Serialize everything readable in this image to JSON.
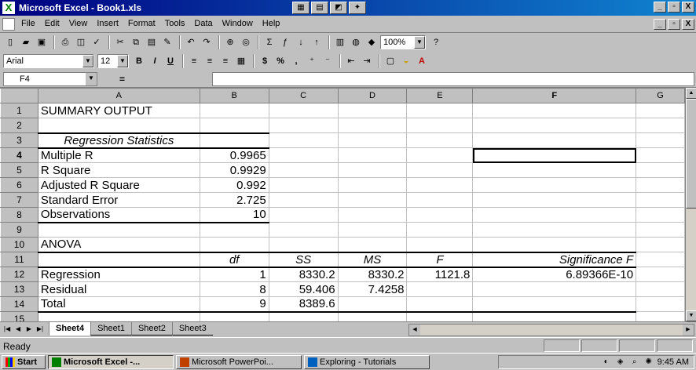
{
  "window": {
    "title": "Microsoft Excel - Book1.xls",
    "controls": [
      "_",
      "▫",
      "X"
    ]
  },
  "menubar": {
    "items": [
      "File",
      "Edit",
      "View",
      "Insert",
      "Format",
      "Tools",
      "Data",
      "Window",
      "Help"
    ],
    "controls": [
      "_",
      "▫",
      "X"
    ]
  },
  "toolbar": {
    "zoom": "100%"
  },
  "format_toolbar": {
    "font": "Arial",
    "size": "12",
    "bold": "B",
    "italic": "I",
    "underline": "U",
    "currency": "$",
    "percent": "%",
    "comma": ","
  },
  "formula_bar": {
    "cell_ref": "F4",
    "eq": "=",
    "content": ""
  },
  "columns": [
    "A",
    "B",
    "C",
    "D",
    "E",
    "F",
    "G"
  ],
  "rows": [
    {
      "n": "1",
      "cells": [
        "SUMMARY OUTPUT",
        "",
        "",
        "",
        "",
        ""
      ]
    },
    {
      "n": "2",
      "cells": [
        "",
        "",
        "",
        "",
        "",
        ""
      ]
    },
    {
      "n": "3",
      "cells": [
        "Regression Statistics",
        "",
        "",
        "",
        "",
        ""
      ]
    },
    {
      "n": "4",
      "cells": [
        "Multiple R",
        "0.9965",
        "",
        "",
        "",
        ""
      ]
    },
    {
      "n": "5",
      "cells": [
        "R Square",
        "0.9929",
        "",
        "",
        "",
        ""
      ]
    },
    {
      "n": "6",
      "cells": [
        "Adjusted R Square",
        "0.992",
        "",
        "",
        "",
        ""
      ]
    },
    {
      "n": "7",
      "cells": [
        "Standard Error",
        "2.725",
        "",
        "",
        "",
        ""
      ]
    },
    {
      "n": "8",
      "cells": [
        "Observations",
        "10",
        "",
        "",
        "",
        ""
      ]
    },
    {
      "n": "9",
      "cells": [
        "",
        "",
        "",
        "",
        "",
        ""
      ]
    },
    {
      "n": "10",
      "cells": [
        "ANOVA",
        "",
        "",
        "",
        "",
        ""
      ]
    },
    {
      "n": "11",
      "cells": [
        "",
        "df",
        "SS",
        "MS",
        "F",
        "Significance F"
      ]
    },
    {
      "n": "12",
      "cells": [
        "Regression",
        "1",
        "8330.2",
        "8330.2",
        "1121.8",
        "6.89366E-10"
      ]
    },
    {
      "n": "13",
      "cells": [
        "Residual",
        "8",
        "59.406",
        "7.4258",
        "",
        ""
      ]
    },
    {
      "n": "14",
      "cells": [
        "Total",
        "9",
        "8389.6",
        "",
        "",
        ""
      ]
    },
    {
      "n": "15",
      "cells": [
        "",
        "",
        "",
        "",
        "",
        ""
      ]
    }
  ],
  "sheet_tabs": [
    "Sheet4",
    "Sheet1",
    "Sheet2",
    "Sheet3"
  ],
  "active_tab": "Sheet4",
  "status": {
    "text": "Ready"
  },
  "taskbar": {
    "start": "Start",
    "tasks": [
      "Microsoft Excel -...",
      "Microsoft PowerPoi...",
      "Exploring - Tutorials"
    ],
    "clock": "9:45 AM"
  }
}
